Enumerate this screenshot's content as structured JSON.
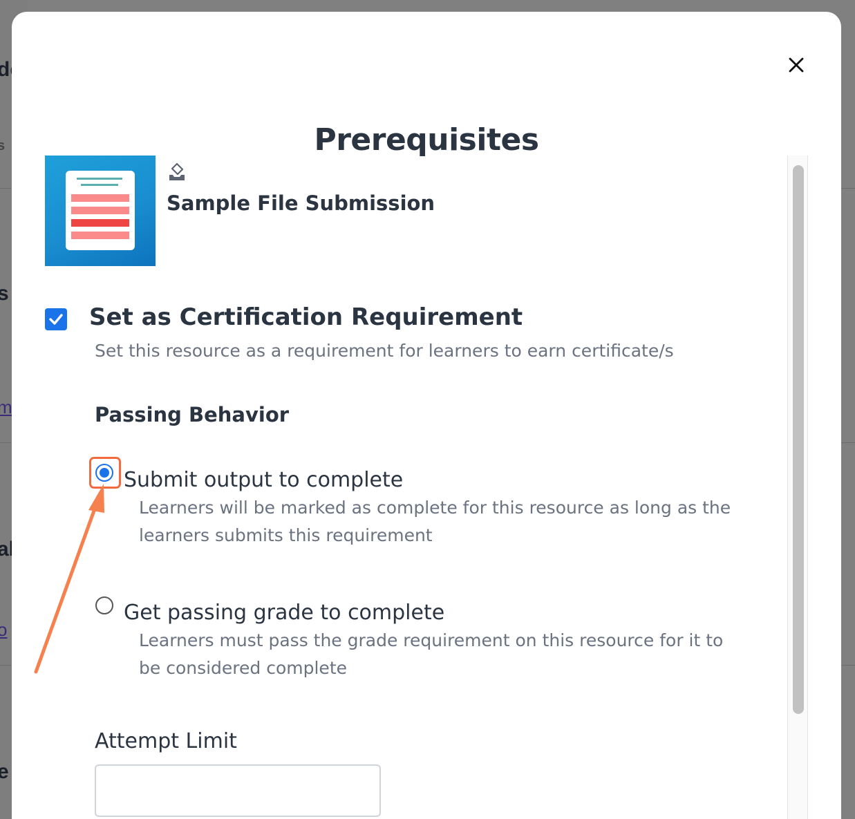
{
  "background": {
    "fragments": [
      "de",
      "s",
      "s",
      "m",
      "ab",
      "o",
      "e"
    ]
  },
  "modal": {
    "title": "Prerequisites",
    "close_icon": "close-icon"
  },
  "resource": {
    "title": "Sample File Submission",
    "type_icon": "file-submission-icon",
    "thumbnail_icon": "document-icon",
    "colors": {
      "thumb_bg": "#1a8ed0",
      "header_lines": "#5aafb0",
      "row_light": "#fb8a8a",
      "row_dark": "#ef4444"
    }
  },
  "certification": {
    "checked": true,
    "title": "Set as Certification Requirement",
    "description": "Set this resource as a requirement for learners to earn certificate/s"
  },
  "passing_behavior": {
    "label": "Passing Behavior",
    "options": [
      {
        "label": "Submit output to complete",
        "description_lines": [
          "Learners will be marked as complete for this resource as long as the",
          "learners submits this requirement"
        ],
        "selected": true
      },
      {
        "label": "Get passing grade to complete",
        "description_lines": [
          "Learners must pass the grade requirement on this resource for it to",
          "be considered complete"
        ],
        "selected": false
      }
    ]
  },
  "attempt_limit": {
    "label": "Attempt Limit",
    "value": "",
    "placeholder": ""
  },
  "annotation": {
    "color": "#f26a3d"
  },
  "accent_color": "#1a73e8"
}
